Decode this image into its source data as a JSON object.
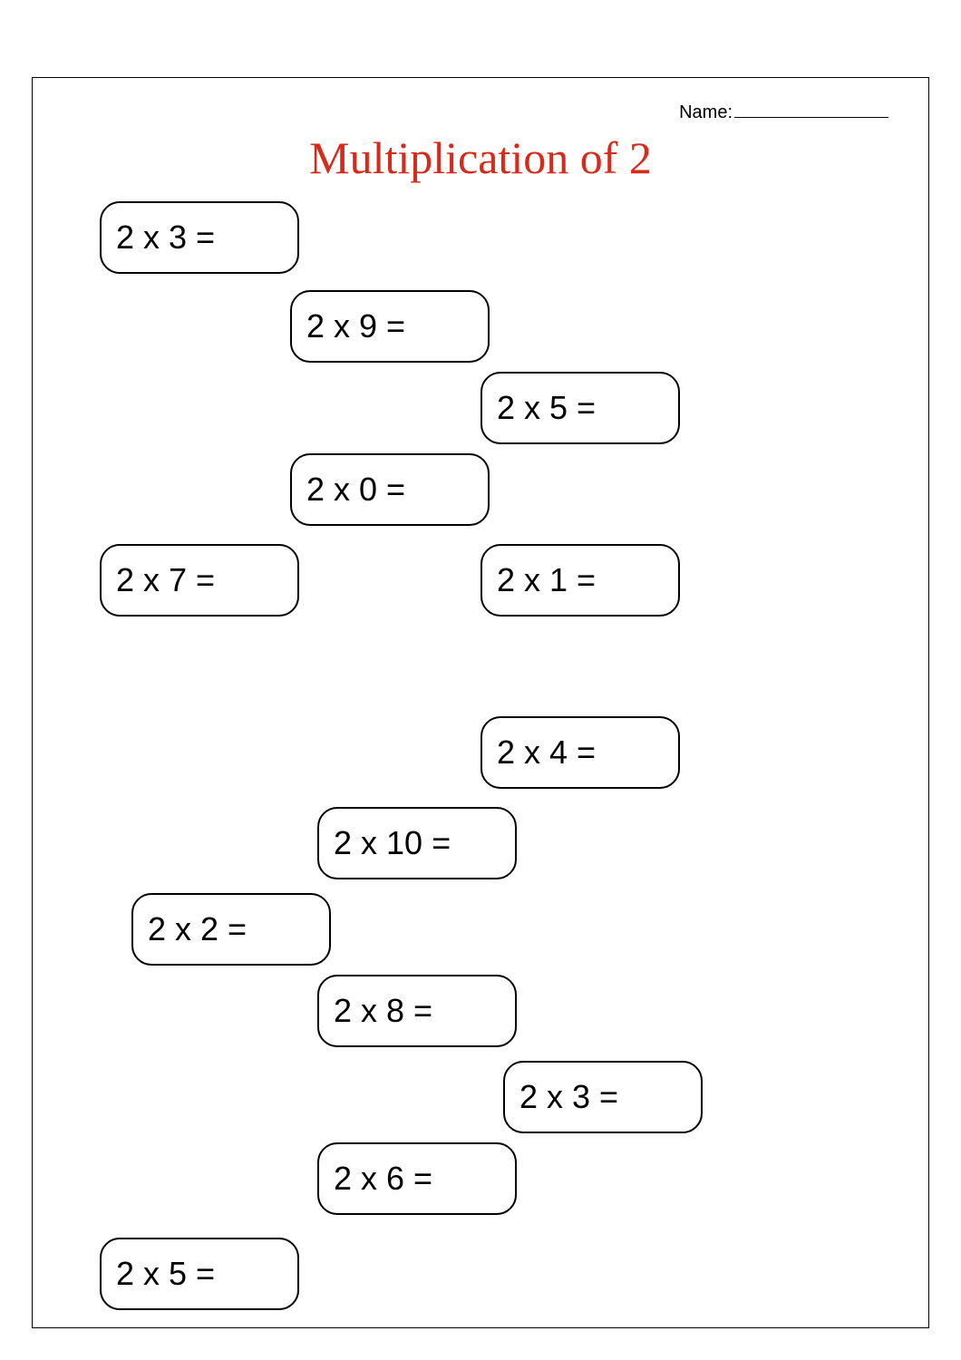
{
  "header": {
    "name_label": "Name:"
  },
  "title": "Multiplication of 2",
  "problems": [
    {
      "text": "2 x 3 ="
    },
    {
      "text": "2 x 9 ="
    },
    {
      "text": "2 x 5 ="
    },
    {
      "text": "2 x 0 ="
    },
    {
      "text": "2 x 7 ="
    },
    {
      "text": "2 x 1 ="
    },
    {
      "text": "2 x 4 ="
    },
    {
      "text": "2 x 10 ="
    },
    {
      "text": "2 x 2 ="
    },
    {
      "text": "2 x 8 ="
    },
    {
      "text": "2 x 3 ="
    },
    {
      "text": "2 x 6 ="
    },
    {
      "text": "2 x 5 ="
    }
  ]
}
